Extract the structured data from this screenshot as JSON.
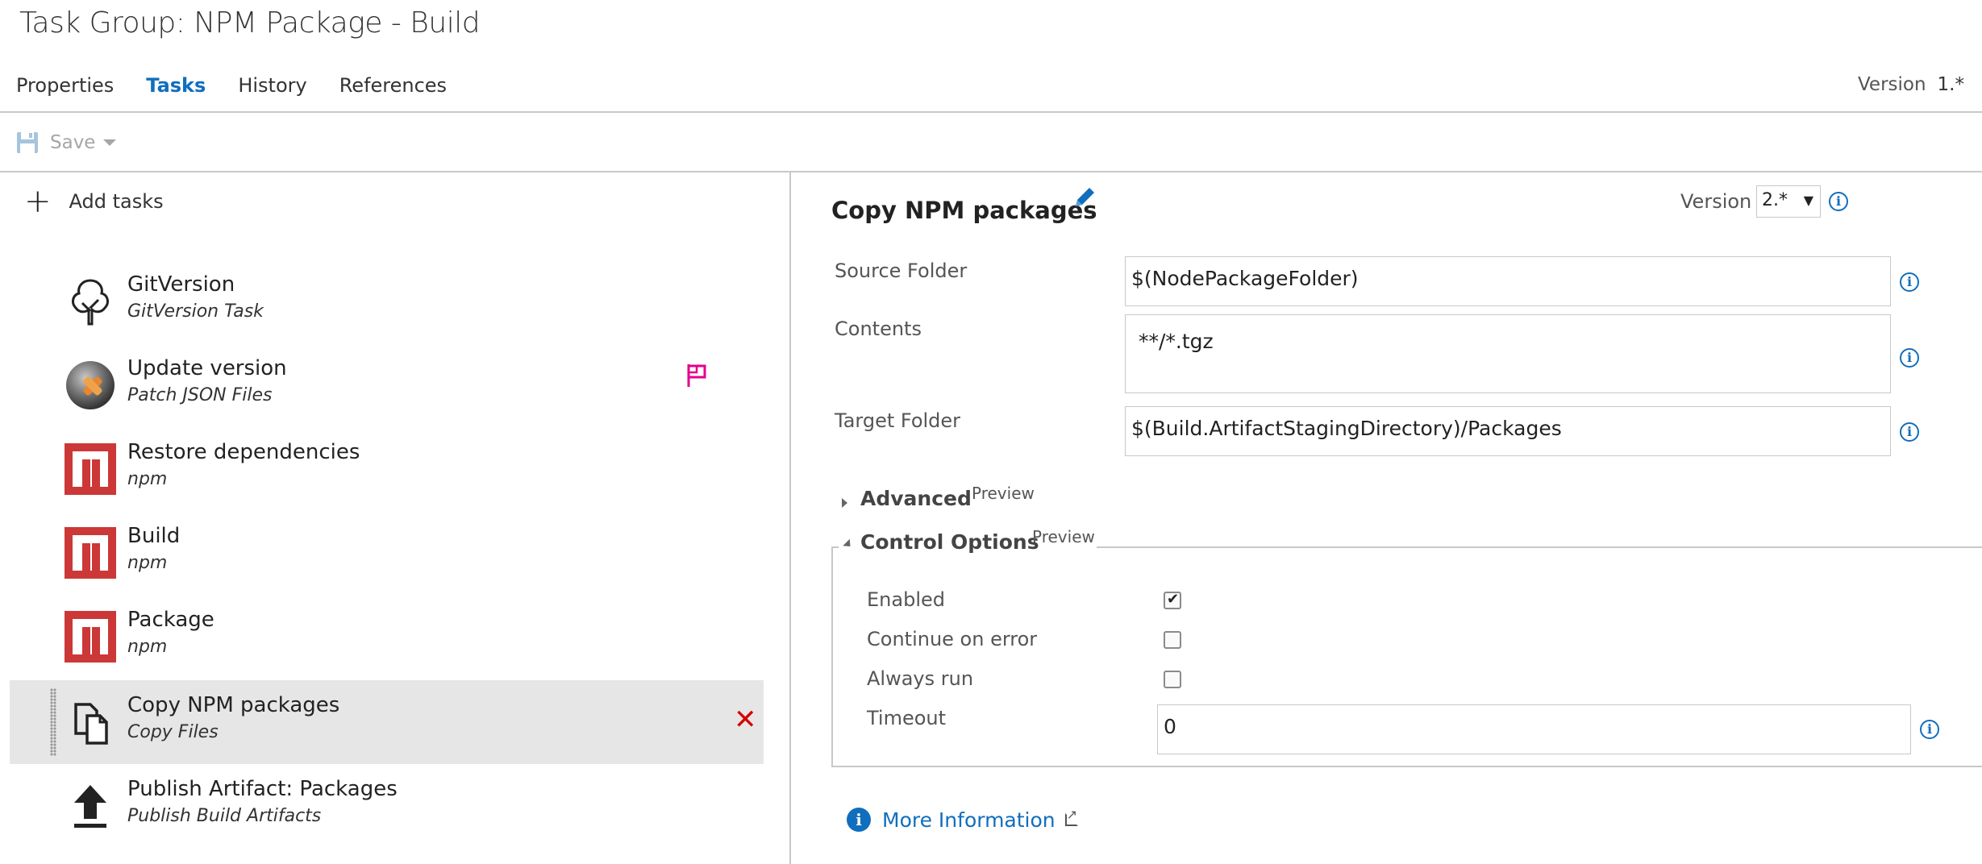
{
  "title": "Task Group: NPM Package - Build",
  "tabs": [
    {
      "label": "Properties",
      "active": false
    },
    {
      "label": "Tasks",
      "active": true
    },
    {
      "label": "History",
      "active": false
    },
    {
      "label": "References",
      "active": false
    }
  ],
  "header_version": {
    "label": "Version",
    "value": "1.*"
  },
  "toolbar": {
    "save_label": "Save"
  },
  "left_panel": {
    "add_tasks_label": "Add tasks",
    "tasks": [
      {
        "name": "GitVersion",
        "subtitle": "GitVersion Task",
        "icon": "tree-icon"
      },
      {
        "name": "Update version",
        "subtitle": "Patch JSON Files",
        "icon": "patch-icon",
        "flag": true
      },
      {
        "name": "Restore dependencies",
        "subtitle": "npm",
        "icon": "npm-icon"
      },
      {
        "name": "Build",
        "subtitle": "npm",
        "icon": "npm-icon"
      },
      {
        "name": "Package",
        "subtitle": "npm",
        "icon": "npm-icon"
      },
      {
        "name": "Copy NPM packages",
        "subtitle": "Copy Files",
        "icon": "copy-files-icon",
        "selected": true
      },
      {
        "name": "Publish Artifact: Packages",
        "subtitle": "Publish Build Artifacts",
        "icon": "upload-icon"
      }
    ]
  },
  "detail": {
    "title": "Copy NPM packages",
    "version_label": "Version",
    "version_value": "2.*",
    "fields": {
      "source_folder": {
        "label": "Source Folder",
        "value": "$(NodePackageFolder)"
      },
      "contents": {
        "label": "Contents",
        "value": "**/*.tgz"
      },
      "target_folder": {
        "label": "Target Folder",
        "value": "$(Build.ArtifactStagingDirectory)/Packages"
      }
    },
    "advanced": {
      "label": "Advanced",
      "badge": "Preview"
    },
    "control_options": {
      "label": "Control Options",
      "badge": "Preview",
      "enabled": {
        "label": "Enabled",
        "checked": true
      },
      "continue_on_error": {
        "label": "Continue on error",
        "checked": false
      },
      "always_run": {
        "label": "Always run",
        "checked": false
      },
      "timeout": {
        "label": "Timeout",
        "value": "0"
      }
    },
    "more_info_label": "More Information"
  },
  "colors": {
    "accent": "#106ebe",
    "npm_red": "#cb3837",
    "remove_red": "#d40000",
    "flag_pink": "#e3008c"
  }
}
